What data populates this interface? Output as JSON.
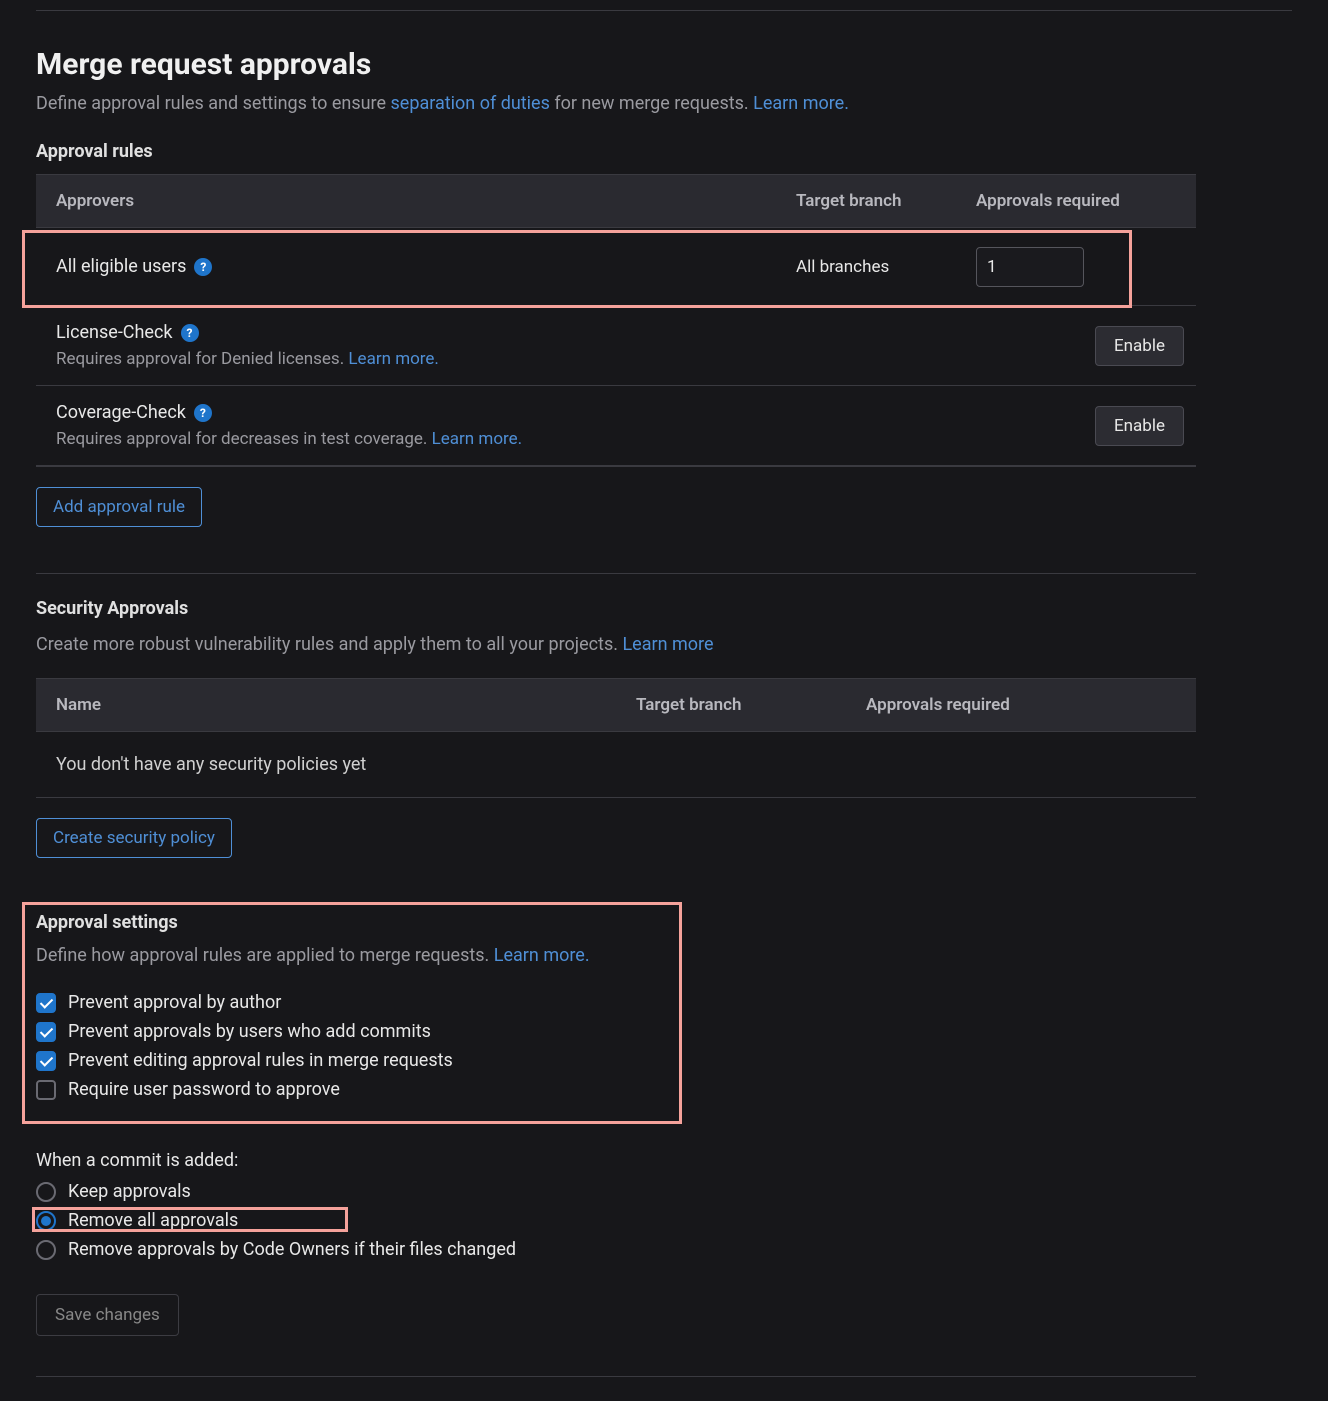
{
  "header": {
    "title": "Merge request approvals",
    "desc_before": "Define approval rules and settings to ensure ",
    "desc_link1": "separation of duties",
    "desc_mid": " for new merge requests. ",
    "desc_link2": "Learn more."
  },
  "approval_rules": {
    "subhead": "Approval rules",
    "columns": {
      "approvers": "Approvers",
      "target": "Target branch",
      "required": "Approvals required"
    },
    "rows": [
      {
        "title": "All eligible users",
        "has_help": true,
        "target": "All branches",
        "required_value": "1",
        "has_input": true,
        "has_enable": false
      },
      {
        "title": "License-Check",
        "has_help": true,
        "sub_before": "Requires approval for Denied licenses. ",
        "sub_link": "Learn more.",
        "has_input": false,
        "enable_label": "Enable",
        "has_enable": true
      },
      {
        "title": "Coverage-Check",
        "has_help": true,
        "sub_before": "Requires approval for decreases in test coverage. ",
        "sub_link": "Learn more.",
        "has_input": false,
        "enable_label": "Enable",
        "has_enable": true
      }
    ],
    "add_button": "Add approval rule"
  },
  "security": {
    "subhead": "Security Approvals",
    "desc_before": "Create more robust vulnerability rules and apply them to all your projects. ",
    "desc_link": "Learn more",
    "columns": {
      "name": "Name",
      "target": "Target branch",
      "required": "Approvals required"
    },
    "empty": "You don't have any security policies yet",
    "create_button": "Create security policy"
  },
  "settings": {
    "subhead": "Approval settings",
    "desc_before": "Define how approval rules are applied to merge requests. ",
    "desc_link": "Learn more.",
    "checkboxes": [
      {
        "label": "Prevent approval by author",
        "checked": true
      },
      {
        "label": "Prevent approvals by users who add commits",
        "checked": true
      },
      {
        "label": "Prevent editing approval rules in merge requests",
        "checked": true
      },
      {
        "label": "Require user password to approve",
        "checked": false
      }
    ],
    "radio_head": "When a commit is added:",
    "radios": [
      {
        "label": "Keep approvals",
        "selected": false
      },
      {
        "label": "Remove all approvals",
        "selected": true
      },
      {
        "label": "Remove approvals by Code Owners if their files changed",
        "selected": false
      }
    ],
    "save_button": "Save changes"
  }
}
